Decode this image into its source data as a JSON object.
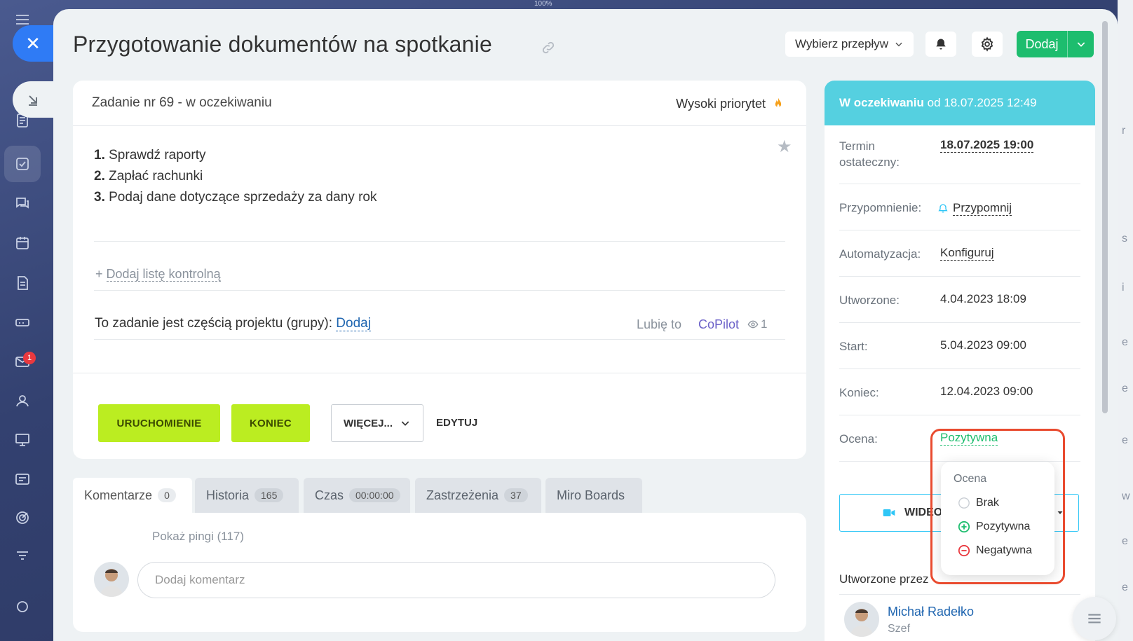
{
  "zoom": "100%",
  "title": "Przygotowanie dokumentów na spotkanie",
  "header": {
    "flow_select": "Wybierz przepływ",
    "add_label": "Dodaj"
  },
  "task": {
    "status": "Zadanie nr 69 - w oczekiwaniu",
    "priority": "Wysoki priorytet",
    "items": [
      {
        "num": "1.",
        "text": " Sprawdź raporty"
      },
      {
        "num": "2.",
        "text": " Zapłać rachunki"
      },
      {
        "num": "3.",
        "text": " Podaj dane dotyczące sprzedaży za dany rok"
      }
    ],
    "checklist_plus": "+ ",
    "checklist": "Dodaj listę kontrolną",
    "project_text": "To zadanie jest częścią projektu (grupy): ",
    "project_link": "Dodaj",
    "like": "Lubię to",
    "copilot": "CoPilot",
    "views": "1",
    "buttons": {
      "start": "URUCHOMIENIE",
      "end": "KONIEC",
      "more": "WIĘCEJ...",
      "edit": "EDYTUJ"
    }
  },
  "tabs": [
    {
      "label": "Komentarze",
      "count": "0"
    },
    {
      "label": "Historia",
      "count": "165"
    },
    {
      "label": "Czas",
      "count": "00:00:00"
    },
    {
      "label": "Zastrzeżenia",
      "count": "37"
    },
    {
      "label": "Miro Boards",
      "count": ""
    }
  ],
  "comments": {
    "pings": "Pokaż pingi (117)",
    "placeholder": "Dodaj komentarz"
  },
  "sidebar": {
    "head_bold": "W oczekiwaniu",
    "head_rest": " od 18.07.2025 12:49",
    "deadline_label1": "Termin",
    "deadline_label2": "ostateczny:",
    "deadline": "18.07.2025 19:00",
    "reminder_label": "Przypomnienie:",
    "reminder": "Przypomnij",
    "automation_label": "Automatyzacja:",
    "automation": "Konfiguruj",
    "created_label": "Utworzone:",
    "created": "4.04.2023 18:09",
    "start_label": "Start:",
    "start": "5.04.2023 09:00",
    "end_label": "Koniec:",
    "end": "12.04.2023 09:00",
    "rating_label": "Ocena:",
    "rating": "Pozytywna",
    "video_label": "WIDEO",
    "created_by": "Utworzone przez",
    "creator_name": "Michał Radełko",
    "creator_role": "Szef"
  },
  "rating_popup": {
    "title": "Ocena",
    "options": [
      "Brak",
      "Pozytywna",
      "Negatywna"
    ]
  },
  "notifications_badge": "1",
  "colors": {
    "accent_green": "#1dbd6e",
    "lime": "#bbed21",
    "status_cyan": "#55d0e0",
    "highlight": "#e94b2f",
    "link": "#2066b0"
  }
}
